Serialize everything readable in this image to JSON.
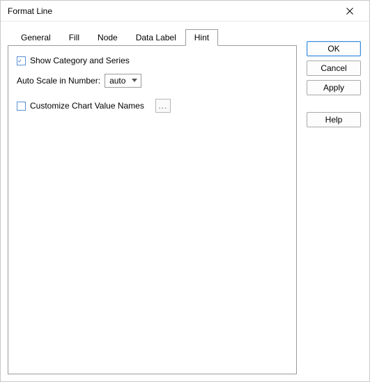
{
  "window": {
    "title": "Format Line"
  },
  "tabs": {
    "items": [
      {
        "label": "General"
      },
      {
        "label": "Fill"
      },
      {
        "label": "Node"
      },
      {
        "label": "Data Label"
      },
      {
        "label": "Hint"
      }
    ],
    "active_index": 4
  },
  "form": {
    "show_category_series": {
      "label": "Show Category and Series",
      "checked": true
    },
    "auto_scale": {
      "label": "Auto Scale in Number:",
      "value": "auto"
    },
    "customize_values": {
      "label": "Customize Chart Value Names",
      "checked": false,
      "button": "..."
    }
  },
  "buttons": {
    "ok": "OK",
    "cancel": "Cancel",
    "apply": "Apply",
    "help": "Help"
  }
}
